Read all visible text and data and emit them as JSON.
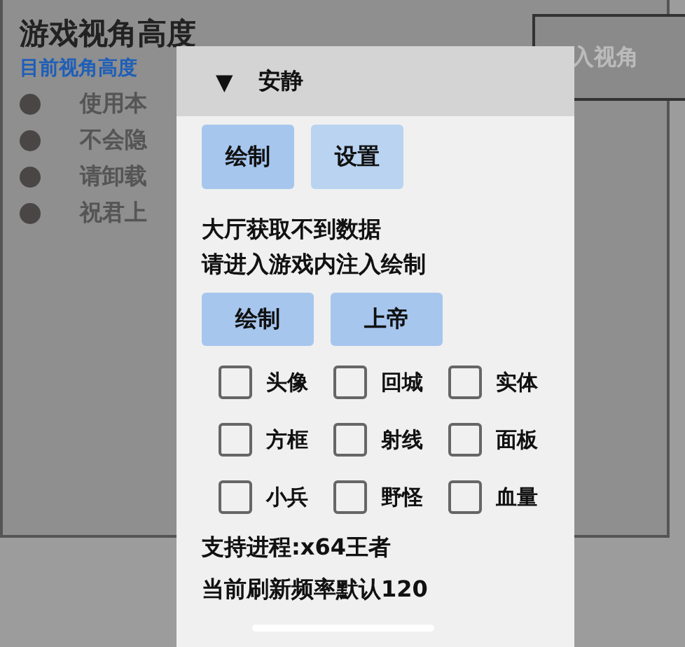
{
  "background_window": {
    "title": "游戏视角高度",
    "subtitle": "目前视角高度",
    "bullets": [
      "使用本",
      "不会隐",
      "请卸载",
      "祝君上"
    ],
    "write_button": "入视角"
  },
  "panel": {
    "header": {
      "arrow": "▼",
      "title": "安静",
      "expanded": true
    },
    "tabs": [
      {
        "label": "绘制",
        "selected": true
      },
      {
        "label": "设置",
        "selected": false
      }
    ],
    "messages": [
      "大厅获取不到数据",
      "请进入游戏内注入绘制"
    ],
    "actions": [
      "绘制",
      "上帝"
    ],
    "options": [
      {
        "label": "头像",
        "checked": false
      },
      {
        "label": "回城",
        "checked": false
      },
      {
        "label": "实体",
        "checked": false
      },
      {
        "label": "方框",
        "checked": false
      },
      {
        "label": "射线",
        "checked": false
      },
      {
        "label": "面板",
        "checked": false
      },
      {
        "label": "小兵",
        "checked": false
      },
      {
        "label": "野怪",
        "checked": false
      },
      {
        "label": "血量",
        "checked": false
      }
    ],
    "footer": [
      "支持进程:x64王者",
      "当前刷新频率默认120"
    ]
  }
}
